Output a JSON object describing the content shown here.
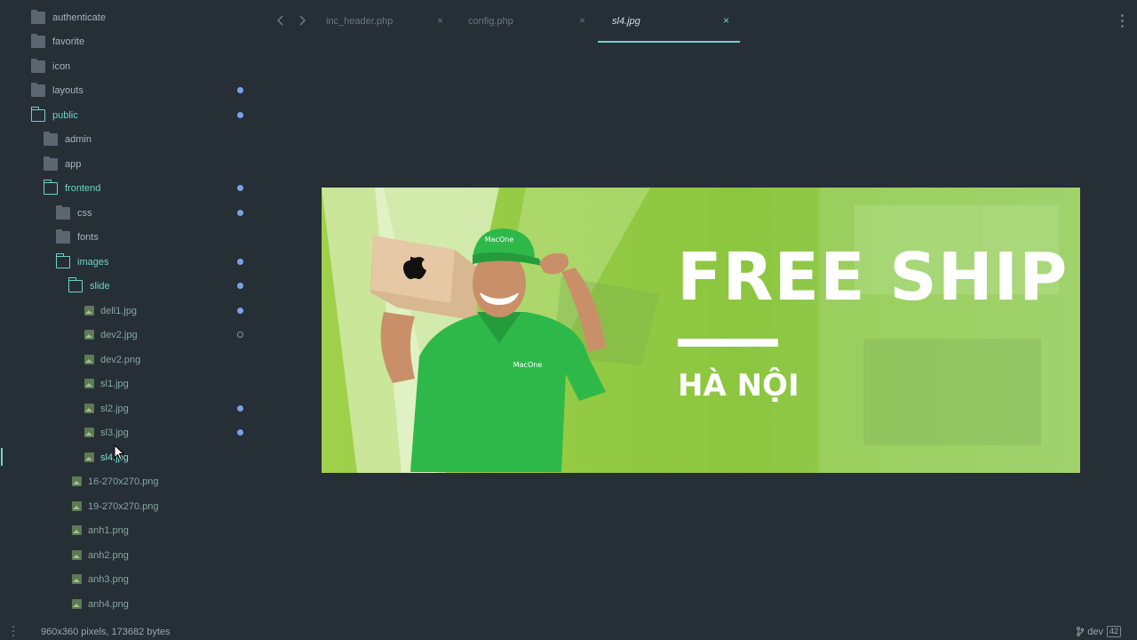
{
  "tabs": {
    "items": [
      {
        "label": "inc_header.php",
        "close": "×"
      },
      {
        "label": "config.php",
        "close": "×"
      },
      {
        "label": "sl4.jpg",
        "close": "×"
      }
    ],
    "back_icon": "chevron-left-icon",
    "forward_icon": "chevron-right-icon"
  },
  "sidebar": {
    "items": [
      {
        "label": "authenticate",
        "type": "folder"
      },
      {
        "label": "favorite",
        "type": "folder"
      },
      {
        "label": "icon",
        "type": "folder"
      },
      {
        "label": "layouts",
        "type": "folder",
        "modified": true
      },
      {
        "label": "public",
        "type": "folder-open",
        "modified": true
      },
      {
        "label": "admin",
        "type": "folder"
      },
      {
        "label": "app",
        "type": "folder"
      },
      {
        "label": "frontend",
        "type": "folder-open",
        "modified": true
      },
      {
        "label": "css",
        "type": "folder",
        "modified": true
      },
      {
        "label": "fonts",
        "type": "folder"
      },
      {
        "label": "images",
        "type": "folder-open",
        "modified": true
      },
      {
        "label": "slide",
        "type": "folder-open",
        "modified": true
      },
      {
        "label": "dell1.jpg",
        "type": "image",
        "modified": true
      },
      {
        "label": "dev2.jpg",
        "type": "image",
        "untracked": true
      },
      {
        "label": "dev2.png",
        "type": "image"
      },
      {
        "label": "sl1.jpg",
        "type": "image"
      },
      {
        "label": "sl2.jpg",
        "type": "image",
        "modified": true
      },
      {
        "label": "sl3.jpg",
        "type": "image",
        "modified": true
      },
      {
        "label": "sl4.jpg",
        "type": "image",
        "active": true
      },
      {
        "label": "16-270x270.png",
        "type": "image"
      },
      {
        "label": "19-270x270.png",
        "type": "image"
      },
      {
        "label": "anh1.png",
        "type": "image"
      },
      {
        "label": "anh2.png",
        "type": "image"
      },
      {
        "label": "anh3.png",
        "type": "image"
      },
      {
        "label": "anh4.png",
        "type": "image"
      }
    ]
  },
  "viewer": {
    "banner_title": "FREE SHIP",
    "banner_subtitle": "HÀ NỘI",
    "logo_text": "MacOne",
    "colors": {
      "banner_green": "#8cc63f",
      "shirt_green": "#2fb84a"
    }
  },
  "statusbar": {
    "info": "960x360 pixels, 173682 bytes",
    "branch": "dev",
    "badge": "42"
  },
  "colors": {
    "background": "#262e36",
    "accent": "#6fd3c9",
    "modified_dot": "#7aa2e8"
  }
}
